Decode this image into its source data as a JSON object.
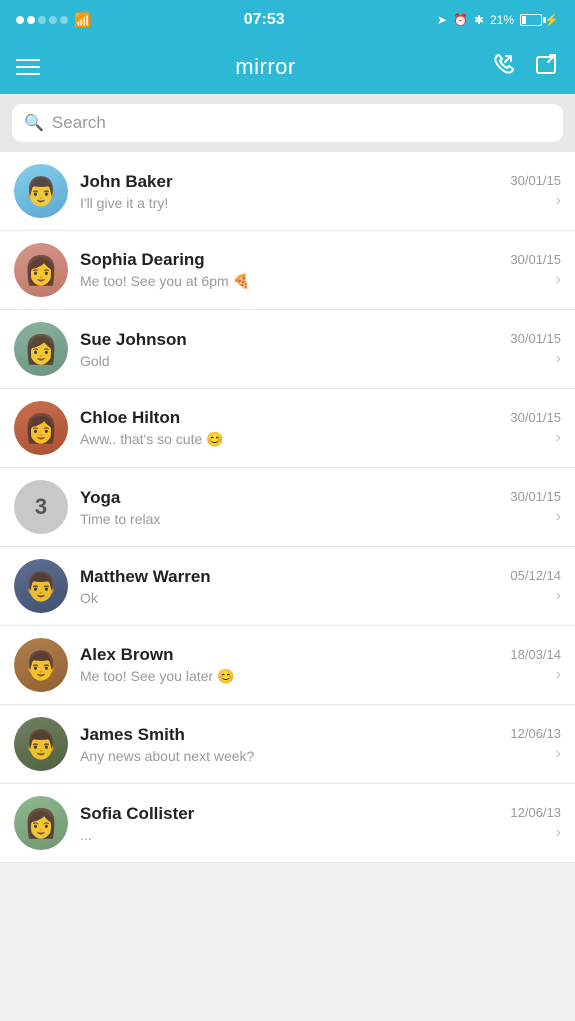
{
  "statusBar": {
    "time": "07:53",
    "battery": "21%",
    "signal": [
      true,
      true,
      false,
      false,
      false
    ]
  },
  "header": {
    "title": "mirror",
    "menuLabel": "Menu",
    "callIconLabel": "Calls",
    "composeIconLabel": "Compose"
  },
  "search": {
    "placeholder": "Search"
  },
  "conversations": [
    {
      "id": "john-baker",
      "name": "John Baker",
      "preview": "I'll give it a try!",
      "date": "30/01/15",
      "avatarEmoji": "👨",
      "avatarClass": "face-john"
    },
    {
      "id": "sophia-dearing",
      "name": "Sophia Dearing",
      "preview": "Me too! See you at 6pm 🍕",
      "date": "30/01/15",
      "avatarEmoji": "👩",
      "avatarClass": "face-sophia"
    },
    {
      "id": "sue-johnson",
      "name": "Sue Johnson",
      "preview": "Gold",
      "date": "30/01/15",
      "avatarEmoji": "👩",
      "avatarClass": "face-sue"
    },
    {
      "id": "chloe-hilton",
      "name": "Chloe Hilton",
      "preview": "Aww.. that's so cute 😊",
      "date": "30/01/15",
      "avatarEmoji": "👩",
      "avatarClass": "face-chloe"
    },
    {
      "id": "yoga",
      "name": "Yoga",
      "preview": "Time to relax",
      "date": "30/01/15",
      "avatarEmoji": "3",
      "avatarClass": "avatar-yoga",
      "isGroup": true
    },
    {
      "id": "matthew-warren",
      "name": "Matthew Warren",
      "preview": "Ok",
      "date": "05/12/14",
      "avatarEmoji": "👨",
      "avatarClass": "face-matthew"
    },
    {
      "id": "alex-brown",
      "name": "Alex Brown",
      "preview": "Me too! See you later 😊",
      "date": "18/03/14",
      "avatarEmoji": "👨",
      "avatarClass": "face-alex"
    },
    {
      "id": "james-smith",
      "name": "James Smith",
      "preview": "Any news about next week?",
      "date": "12/06/13",
      "avatarEmoji": "👨",
      "avatarClass": "face-james"
    },
    {
      "id": "sofia-collister",
      "name": "Sofia Collister",
      "preview": "...",
      "date": "12/06/13",
      "avatarEmoji": "👩",
      "avatarClass": "face-sofiac"
    }
  ]
}
